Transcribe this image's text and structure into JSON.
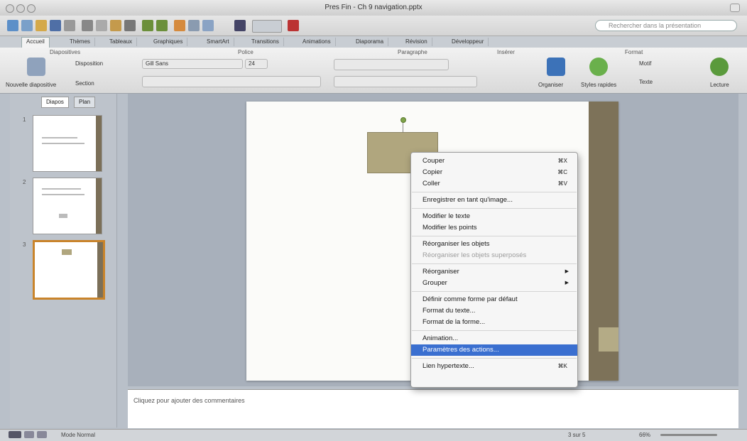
{
  "window": {
    "title": "Pres Fin - Ch 9 navigation.pptx",
    "search_placeholder": "Rechercher dans la présentation"
  },
  "ribbon": {
    "tabs": [
      "Accueil",
      "Thèmes",
      "Tableaux",
      "Graphiques",
      "SmartArt",
      "Transitions",
      "Animations",
      "Diaporama",
      "Révision",
      "Développeur"
    ],
    "active_tab": "Accueil",
    "groups": [
      "Diapositives",
      "Police",
      "Paragraphe",
      "Insérer",
      "Format"
    ],
    "font_name": "Gill Sans",
    "font_size": "24",
    "new_slide": "Nouvelle diapositive",
    "layout": "Disposition",
    "section": "Section",
    "arrange": "Organiser",
    "quick_styles": "Styles rapides",
    "pattern": "Motif",
    "text": "Texte",
    "play": "Lecture"
  },
  "slides_pane": {
    "tabs": [
      "Diapos",
      "Plan"
    ],
    "active_tab": "Diapos",
    "slide_numbers": [
      "1",
      "2",
      "3"
    ]
  },
  "notes": {
    "placeholder": "Cliquez pour ajouter des commentaires"
  },
  "context_menu": {
    "items": [
      {
        "label": "Couper",
        "shortcut": "⌘X",
        "disabled": false
      },
      {
        "label": "Copier",
        "shortcut": "⌘C",
        "disabled": false
      },
      {
        "label": "Coller",
        "shortcut": "⌘V",
        "disabled": false
      },
      {
        "separator": true
      },
      {
        "label": "Enregistrer en tant qu'image...",
        "disabled": false
      },
      {
        "separator": true
      },
      {
        "label": "Modifier le texte",
        "disabled": false
      },
      {
        "label": "Modifier les points",
        "disabled": false
      },
      {
        "separator": true
      },
      {
        "label": "Réorganiser les objets",
        "disabled": false
      },
      {
        "label": "Réorganiser les objets superposés",
        "disabled": true
      },
      {
        "separator": true
      },
      {
        "label": "Réorganiser",
        "submenu": true,
        "disabled": false
      },
      {
        "label": "Grouper",
        "submenu": true,
        "disabled": false
      },
      {
        "separator": true
      },
      {
        "label": "Définir comme forme par défaut",
        "disabled": false
      },
      {
        "label": "Format du texte...",
        "disabled": false
      },
      {
        "label": "Format de la forme...",
        "disabled": false
      },
      {
        "separator": true
      },
      {
        "label": "Animation...",
        "disabled": false
      },
      {
        "label": "Paramètres des actions...",
        "highlighted": true,
        "disabled": false
      },
      {
        "separator": true
      },
      {
        "label": "Lien hypertexte...",
        "shortcut": "⌘K",
        "disabled": false
      }
    ]
  },
  "status": {
    "view": "Mode Normal",
    "slide_indicator": "3 sur 5",
    "zoom": "66%"
  },
  "colors": {
    "accent_band": "#7d7259",
    "shape_fill": "#b0a67e",
    "menu_highlight": "#3a6fd0",
    "thumb_selected": "#c9842b"
  }
}
